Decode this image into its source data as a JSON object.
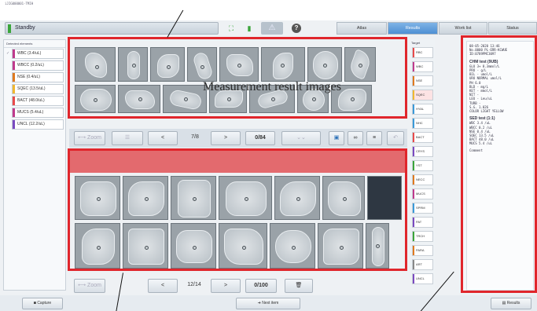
{
  "app": {
    "title": "iJIG000001-TMIH",
    "status": "Standby"
  },
  "toolbar": {
    "icons": [
      "network-icon",
      "battery-icon",
      "warning-icon",
      "help-icon"
    ],
    "help_glyph": "?"
  },
  "tabs": [
    {
      "label": "Atlas",
      "active": false
    },
    {
      "label": "Results",
      "active": true
    },
    {
      "label": "Work list",
      "active": false
    },
    {
      "label": "Status",
      "active": false
    }
  ],
  "detected": {
    "header": "Detected elements",
    "items": [
      {
        "label": "WBC (3.4/uL)",
        "color": "#c03a8c"
      },
      {
        "label": "WBCC (0.2/uL)",
        "color": "#c03a8c"
      },
      {
        "label": "NSE (0.4/uL)",
        "color": "#e07a1f"
      },
      {
        "label": "SQEC (13.5/uL)",
        "color": "#f0b830"
      },
      {
        "label": "BACT (48.0/uL)",
        "color": "#e84a4a"
      },
      {
        "label": "MUCS (5.4/uL)",
        "color": "#c03a8c"
      },
      {
        "label": "UNCL (12.2/uL)",
        "color": "#7a4ac0"
      }
    ]
  },
  "upper_nav": {
    "prev": "<",
    "page": "7/8",
    "next": ">",
    "count": "0/84"
  },
  "lower_nav": {
    "prev": "<",
    "page": "12/14",
    "next": ">",
    "count": "0/100",
    "trash": "🗑"
  },
  "annotation": "Measurement result images",
  "target": {
    "header": "Target",
    "items": [
      {
        "label": "RBC",
        "color": "#e84a4a"
      },
      {
        "label": "WBC",
        "color": "#c03a8c"
      },
      {
        "label": "NSE",
        "color": "#e07a1f"
      },
      {
        "label": "SQEC",
        "color": "#f0b830"
      },
      {
        "label": "HYAL",
        "color": "#3a9ad9"
      },
      {
        "label": "NHC",
        "color": "#3a9ad9"
      },
      {
        "label": "BACT",
        "color": "#e84a4a"
      },
      {
        "label": "CRYS",
        "color": "#7a4ac0"
      },
      {
        "label": "YST",
        "color": "#3aa53a"
      },
      {
        "label": "NECC",
        "color": "#e07a1f"
      },
      {
        "label": "MUCS",
        "color": "#c03a8c"
      },
      {
        "label": "SPRM",
        "color": "#3a9ad9"
      },
      {
        "label": "PAT",
        "color": "#7a4ac0"
      },
      {
        "label": "TRCH",
        "color": "#3aa53a"
      },
      {
        "label": "PARA",
        "color": "#e07a1f"
      },
      {
        "label": "ART",
        "color": "#888888"
      },
      {
        "label": "UNCL",
        "color": "#7a4ac0"
      }
    ]
  },
  "report": {
    "meta": [
      "08-05-2020 13:46",
      "No.0000 PL-ERR-KCWUE",
      "ID:0789PMC3097"
    ],
    "chm_title": "CHM test (9UB)",
    "chm_rows": [
      "GLU   3+    8.3mmol/L",
      "PRO   -        g/L",
      "BIL   -      umol/L",
      "URO  NORMAL umol/L",
      "PH          6.0",
      "BLD   -       mg/L",
      "KET   -    mmol/L",
      "NIT   -",
      "LEU   -      Leu/uL",
      "TURB  -",
      "S.G.        1.026",
      "COLOR   LIGHT YELLOW"
    ],
    "sed_title": "SED test (1:1)",
    "sed_rows": [
      "WBC       3.4  /uL",
      "WBCC      0.2  /uL",
      "NSE       0.4  /uL",
      "SQEC     13.5  /uL",
      "BACT     48.0  /uL",
      "MUCS      5.4  /uL"
    ],
    "comment_label": "Comment"
  },
  "bottom": {
    "capture": "Capture",
    "next": "Next item",
    "results": "Results"
  }
}
